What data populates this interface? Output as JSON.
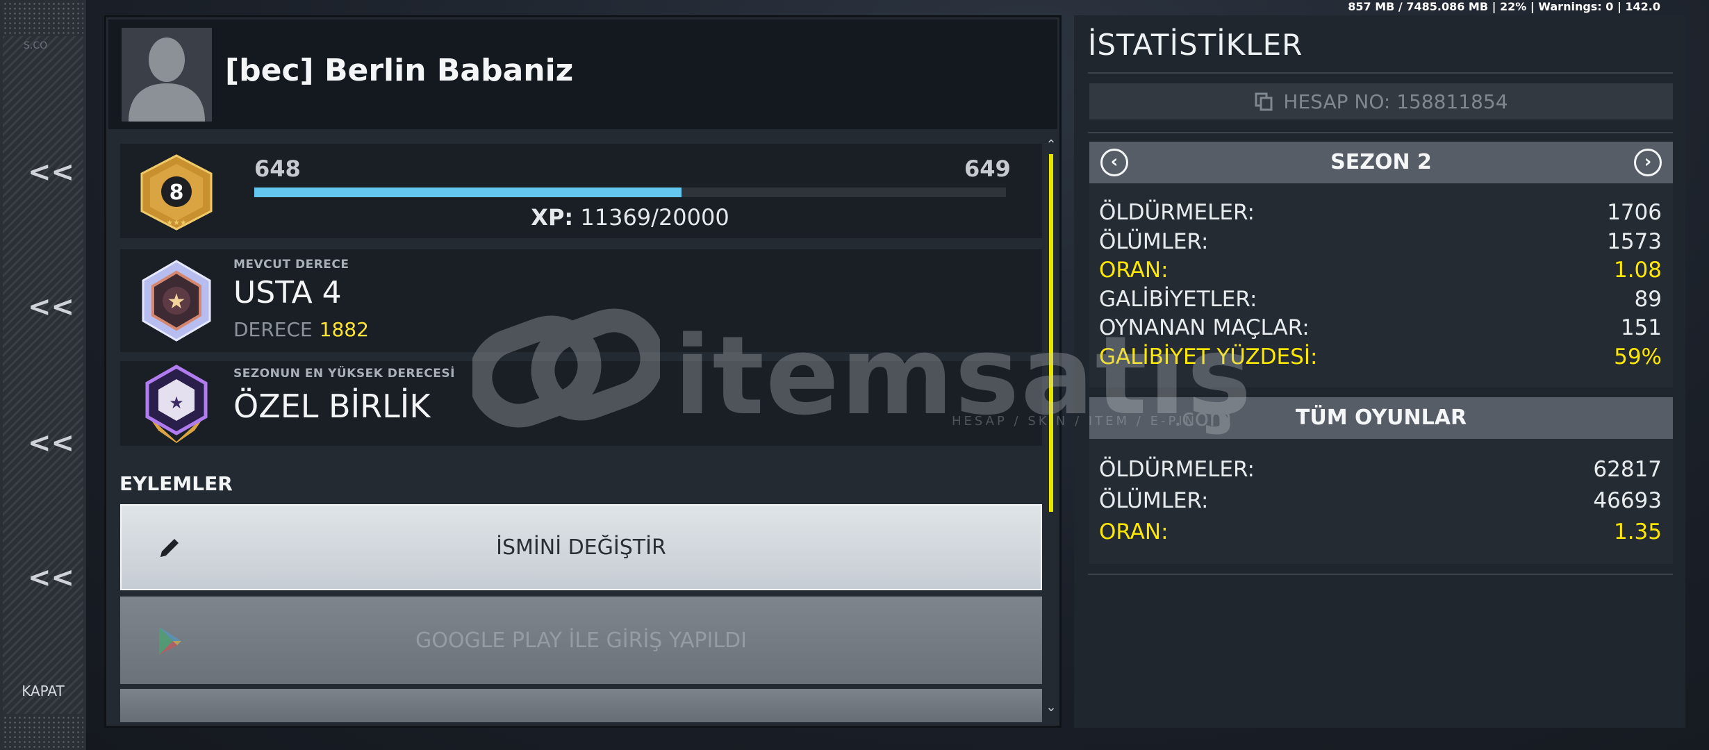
{
  "debug": {
    "text": "857 MB / 7485.086 MB | 22% | Warnings: 0 | 142.0"
  },
  "rail": {
    "fade_label": "S.CO",
    "chevrons": [
      "<<",
      "<<",
      "<<",
      "<<"
    ],
    "close_label": "KAPAT"
  },
  "profile": {
    "name": "[bec] Berlin Babaniz",
    "level": "8",
    "xp_from": "648",
    "xp_to": "649",
    "xp_label": "XP:",
    "xp_value": "11369/20000",
    "xp_progress": 0.5685
  },
  "rank": {
    "current_label": "MEVCUT DERECE",
    "current_name": "USTA 4",
    "rating_label": "DERECE",
    "rating_value": "1882",
    "highest_label": "SEZONUN EN YÜKSEK DERECESİ",
    "highest_name": "ÖZEL BİRLİK"
  },
  "actions": {
    "title": "EYLEMLER",
    "rename_label": "İSMİNİ DEĞİŞTİR",
    "google_label": "GOOGLE PLAY İLE GİRİŞ YAPILDI"
  },
  "stats": {
    "title": "İSTATİSTİKLER",
    "account_label": "HESAP NO: 158811854",
    "season_title": "SEZON 2",
    "season": [
      {
        "label": "ÖLDÜRMELER:",
        "value": "1706",
        "highlight": false
      },
      {
        "label": "ÖLÜMLER:",
        "value": "1573",
        "highlight": false
      },
      {
        "label": "ORAN:",
        "value": "1.08",
        "highlight": true
      },
      {
        "label": "GALİBİYETLER:",
        "value": "89",
        "highlight": false
      },
      {
        "label": "OYNANAN MAÇLAR:",
        "value": "151",
        "highlight": false
      },
      {
        "label": "GALİBİYET YÜZDESİ:",
        "value": "59%",
        "highlight": true
      }
    ],
    "all_title": "TÜM OYUNLAR",
    "all": [
      {
        "label": "ÖLDÜRMELER:",
        "value": "62817",
        "highlight": false
      },
      {
        "label": "ÖLÜMLER:",
        "value": "46693",
        "highlight": false
      },
      {
        "label": "ORAN:",
        "value": "1.35",
        "highlight": true
      }
    ]
  },
  "watermark": {
    "brand": "itemsatış",
    "tagline": "HESAP / SKIN / ITEM / E-PIN",
    "suffix": ".com"
  },
  "colors": {
    "accent_yellow": "#ffe800",
    "xp_blue": "#63c7f0",
    "gold": "#d9a441"
  }
}
